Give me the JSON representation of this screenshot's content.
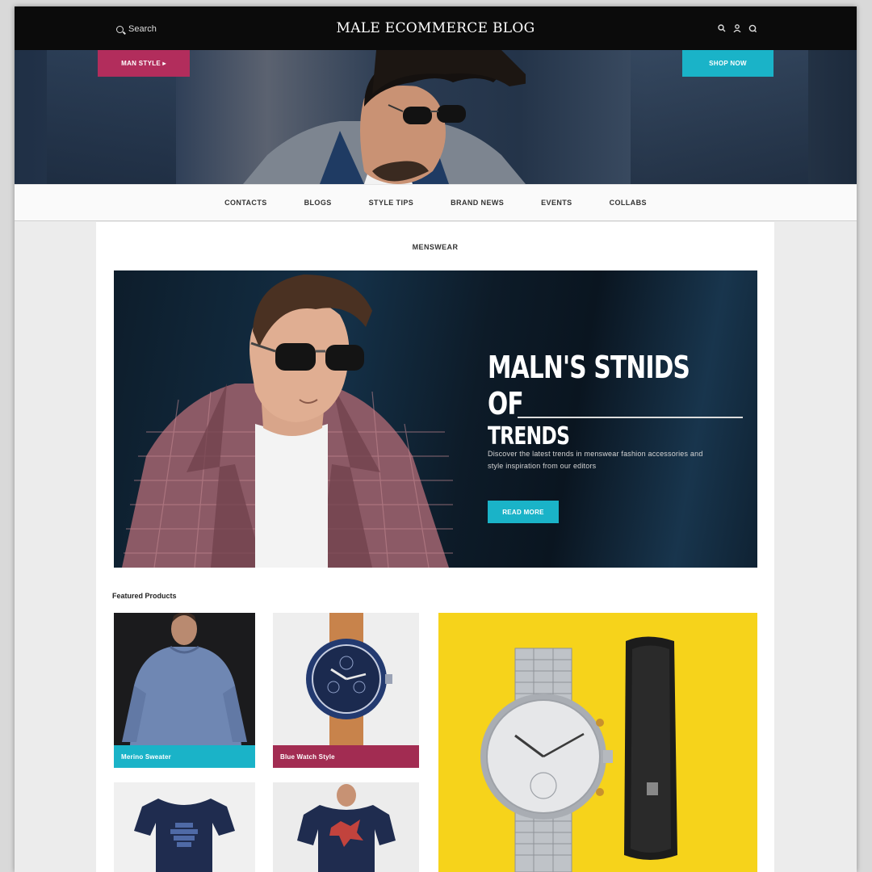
{
  "header": {
    "search_label": "Search",
    "brand": "MALE ECOMMERCE BLOG",
    "icons": [
      "search-icon",
      "user-icon",
      "cart-icon"
    ]
  },
  "banner": {
    "left_button": "MAN STYLE ▸",
    "right_button": "SHOP NOW"
  },
  "nav": {
    "items": [
      "CONTACTS",
      "BLOGS",
      "STYLE TIPS",
      "BRAND NEWS",
      "EVENTS",
      "COLLABS"
    ]
  },
  "main": {
    "section_label": "MENSWEAR",
    "feature": {
      "headline_line1": "MALN'S STNIDS",
      "headline_line2": "OF",
      "headline_line3": "TRENDS",
      "description": "Discover the latest trends in menswear fashion accessories and style inspiration from our editors",
      "cta": "READ MORE"
    },
    "products_label": "Featured Products",
    "products": [
      {
        "caption": "Merino Sweater"
      },
      {
        "caption": "Blue Watch Style"
      }
    ]
  },
  "colors": {
    "accent_teal": "#1ab3c8",
    "accent_magenta": "#b22d5c",
    "yellow": "#f6d31b",
    "dark": "#0b0b0b"
  }
}
